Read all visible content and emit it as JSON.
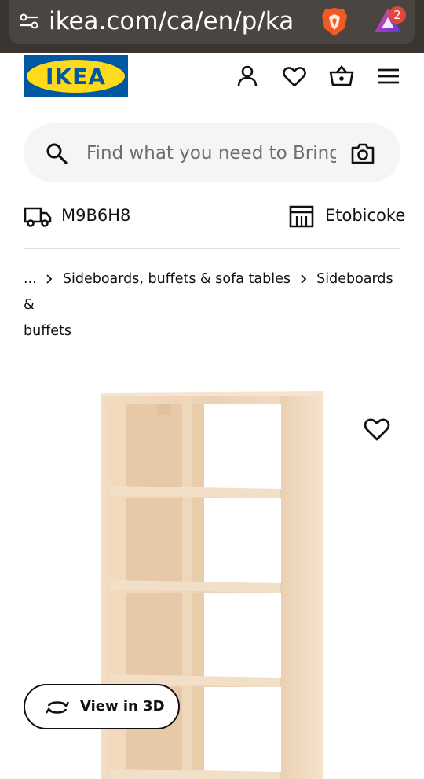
{
  "browser": {
    "url": "ikea.com/ca/en/p/ka",
    "rewards_count": "2"
  },
  "header": {
    "logo_text": "IKEA",
    "icons": [
      "account-icon",
      "heart-icon",
      "basket-icon",
      "menu-icon"
    ]
  },
  "search": {
    "placeholder": "Find what you need to Bring"
  },
  "location": {
    "postal_code": "M9B6H8",
    "store": "Etobicoke"
  },
  "breadcrumb": {
    "ellipsis": "...",
    "items": [
      "Sideboards, buffets & sofa tables",
      "Sideboards &",
      "buffets"
    ]
  },
  "product": {
    "view3d_label": "View in 3D",
    "image_subject": "birch-effect shelving unit with 8 compartments"
  },
  "colors": {
    "browser_bg": "#3a3531",
    "ikea_blue": "#0058a3",
    "ikea_yellow": "#ffda1a",
    "search_bg": "#f5f5f5"
  }
}
